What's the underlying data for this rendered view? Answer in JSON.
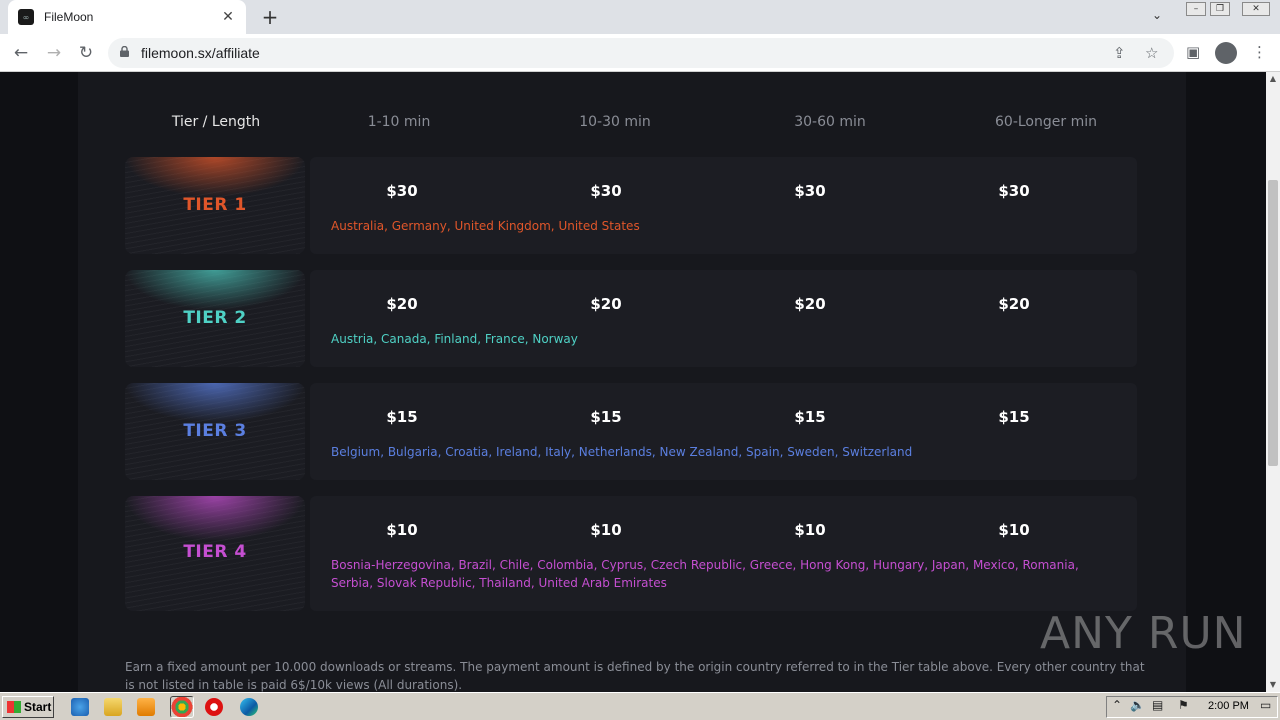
{
  "browser": {
    "tab_title": "FileMoon",
    "url": "filemoon.sx/affiliate",
    "favicon": "filemoon-favicon"
  },
  "table": {
    "headers": [
      "Tier / Length",
      "1-10 min",
      "10-30 min",
      "30-60 min",
      "60-Longer min"
    ],
    "tiers": [
      {
        "name": "TIER 1",
        "color": "#e0562a",
        "prices": [
          "$30",
          "$30",
          "$30",
          "$30"
        ],
        "countries": "Australia, Germany, United Kingdom, United States"
      },
      {
        "name": "TIER 2",
        "color": "#4fd1c5",
        "prices": [
          "$20",
          "$20",
          "$20",
          "$20"
        ],
        "countries": "Austria, Canada, Finland, France, Norway"
      },
      {
        "name": "TIER 3",
        "color": "#5b7fe0",
        "prices": [
          "$15",
          "$15",
          "$15",
          "$15"
        ],
        "countries": "Belgium, Bulgaria, Croatia, Ireland, Italy, Netherlands, New Zealand, Spain, Sweden, Switzerland"
      },
      {
        "name": "TIER 4",
        "color": "#c54fd1",
        "prices": [
          "$10",
          "$10",
          "$10",
          "$10"
        ],
        "countries": "Bosnia-Herzegovina, Brazil, Chile, Colombia, Cyprus, Czech Republic, Greece, Hong Kong, Hungary, Japan, Mexico, Romania, Serbia, Slovak Republic, Thailand, United Arab Emirates"
      }
    ]
  },
  "footer_text": "Earn a fixed amount per 10.000 downloads or streams. The payment amount is defined by the origin country referred to in the Tier table above. Every other country that is not listed in table is paid 6$/10k views (All durations).",
  "watermark": "ANY RUN",
  "taskbar": {
    "start_label": "Start",
    "clock": "2:00 PM"
  }
}
